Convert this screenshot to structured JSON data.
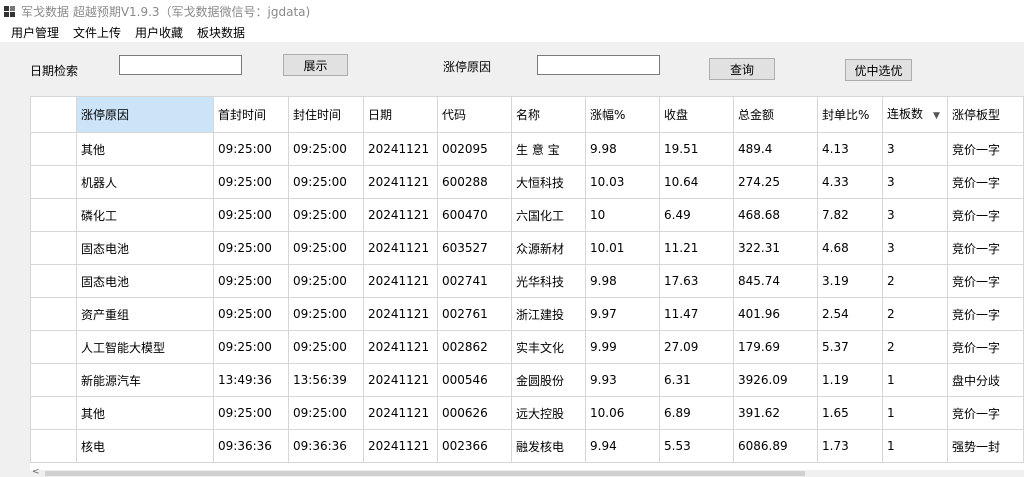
{
  "window": {
    "title": "军戈数据 超越预期V1.9.3（军戈数据微信号：jgdata)"
  },
  "menu": [
    "用户管理",
    "文件上传",
    "用户收藏",
    "板块数据"
  ],
  "toolbar": {
    "date_label": "日期检索",
    "date_value": "",
    "show_button": "展示",
    "reason_label": "涨停原因",
    "reason_value": "",
    "query_button": "查询",
    "select_button": "优中选优"
  },
  "table": {
    "columns": [
      "涨停原因",
      "首封时间",
      "封住时间",
      "日期",
      "代码",
      "名称",
      "涨幅%",
      "收盘",
      "总金额",
      "封单比%",
      "连板数",
      "涨停板型"
    ],
    "rows": [
      [
        "其他",
        "09:25:00",
        "09:25:00",
        "20241121",
        "002095",
        "生 意 宝",
        "9.98",
        "19.51",
        "489.4",
        "4.13",
        "3",
        "竞价一字"
      ],
      [
        "机器人",
        "09:25:00",
        "09:25:00",
        "20241121",
        "600288",
        "大恒科技",
        "10.03",
        "10.64",
        "274.25",
        "4.33",
        "3",
        "竞价一字"
      ],
      [
        "磷化工",
        "09:25:00",
        "09:25:00",
        "20241121",
        "600470",
        "六国化工",
        "10",
        "6.49",
        "468.68",
        "7.82",
        "3",
        "竞价一字"
      ],
      [
        "固态电池",
        "09:25:00",
        "09:25:00",
        "20241121",
        "603527",
        "众源新材",
        "10.01",
        "11.21",
        "322.31",
        "4.68",
        "3",
        "竞价一字"
      ],
      [
        "固态电池",
        "09:25:00",
        "09:25:00",
        "20241121",
        "002741",
        "光华科技",
        "9.98",
        "17.63",
        "845.74",
        "3.19",
        "2",
        "竞价一字"
      ],
      [
        "资产重组",
        "09:25:00",
        "09:25:00",
        "20241121",
        "002761",
        "浙江建投",
        "9.97",
        "11.47",
        "401.96",
        "2.54",
        "2",
        "竞价一字"
      ],
      [
        "人工智能大模型",
        "09:25:00",
        "09:25:00",
        "20241121",
        "002862",
        "实丰文化",
        "9.99",
        "27.09",
        "179.69",
        "5.37",
        "2",
        "竞价一字"
      ],
      [
        "新能源汽车",
        "13:49:36",
        "13:56:39",
        "20241121",
        "000546",
        "金圆股份",
        "9.93",
        "6.31",
        "3926.09",
        "1.19",
        "1",
        "盘中分歧"
      ],
      [
        "其他",
        "09:25:00",
        "09:25:00",
        "20241121",
        "000626",
        "远大控股",
        "10.06",
        "6.89",
        "391.62",
        "1.65",
        "1",
        "竞价一字"
      ],
      [
        "核电",
        "09:36:36",
        "09:36:36",
        "20241121",
        "002366",
        "融发核电",
        "9.94",
        "5.53",
        "6086.89",
        "1.73",
        "1",
        "强势一封"
      ]
    ]
  }
}
